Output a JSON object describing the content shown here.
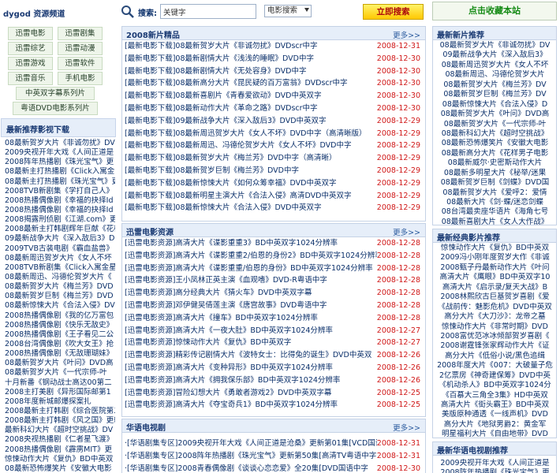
{
  "site": {
    "title": "dygod 资源频道"
  },
  "channels": [
    "迅雷电影",
    "迅雷剧集",
    "迅雷综艺",
    "迅雷动漫",
    "迅雷游戏",
    "迅雷软件",
    "迅雷音乐",
    "手机电影",
    "中英双字幕系列片",
    "粤语DVD电影系列片"
  ],
  "left_panel": {
    "title": "最新推荐影视下载",
    "items": [
      "08最新贺岁大片《非诚勿扰》DV",
      "2009央视开年大戏《人间正道是",
      "2008阵年热播剧《珠光宝气》更",
      "08最新主打热播剧《Click入寓金",
      "08最新主打热播剧《珠光宝气》更",
      "2008TVB新剧集《学打自己人》",
      "2008热播偶像剧《幸福的抉择Id",
      "2008热播偶像剧《幸福的抉择Id",
      "2008揭露刑侦剧《江湖.com》更",
      "2008最新主打韩剧辉年巨献《花样男",
      "09最新战争大片《深入敌后3》D",
      "2009TVB古装电剧《霸血盐兽》",
      "08最新周迅贺岁大片《女人不坏",
      "2008TVB新剧集《Click入寓金星",
      "08最新周迅、冯德伦贺岁大片《",
      "08最新贺岁大片《梅兰芳》DVD",
      "08最新贺岁巨制《梅兰芳》DVD",
      "08最新惊悚大片《合法入侵》DV",
      "2008热播偶像剧《我的亿万富包",
      "2008热播偶像剧《快乐无敌史》",
      "2008热播偶像剧《王子看见二公",
      "2008台湾偶像剧《吹大女王》抢",
      "2008热播偶像剧《无敌珊瑚妹》",
      "08最新贺岁大片《叶问》DVD高",
      "08最新贺岁大片《一代宗师-叶",
      "十月新番《钢动战士高达00第二",
      "2008主打美剧《异形国际邮第1",
      "2008年度新城邮爆探案扎",
      "2008最新主打韩剧《综合医院第二",
      "2008最新主打韩剧《风之国》更新",
      "最新科幻大片《超时空挑战》DV",
      "2008央视热播剧《仁者星飞渡》",
      "2008热播偶像剧《霹雳MIT》更",
      "惊悚动作大片《复仇》BD中英双",
      "08最新恐怖爆笑片《安徽大电影"
    ]
  },
  "search": {
    "label": "搜索:",
    "value": "关键字",
    "category": "电影搜索",
    "button": "立即搜索"
  },
  "sec1": {
    "title": "2008新片精品",
    "more": "更多>>",
    "rows": [
      {
        "text": "[最新电影下载]08最新贺岁大片《非诚勿扰》DVDscr中字",
        "date": "2008-12-31"
      },
      {
        "text": "[最新电影下载]08最新剧情大片《浅浅的睡眠》DVD中字",
        "date": "2008-12-30"
      },
      {
        "text": "[最新电影下载]08最新剧情大片《无处容身》DVD中字",
        "date": "2008-12-30"
      },
      {
        "text": "[最新电影下载]08最新高分大片《昆民疑的百万富翁》DVDscr中字",
        "date": "2008-12-30"
      },
      {
        "text": "[最新电影下载]08最新喜剧片《青春爱欲动》DVD中英双字",
        "date": "2008-12-30"
      },
      {
        "text": "[最新电影下载]08最新动作大片《革命之路》DVDscr中字",
        "date": "2008-12-30"
      },
      {
        "text": "[最新电影下载]09最新战争大片《深入敌后3》DVD中英双字",
        "date": "2008-12-29"
      },
      {
        "text": "[最新电影下载]08最新周迅贺岁大片《女人不坏》DVD中字（高清晰版）",
        "date": "2008-12-29"
      },
      {
        "text": "[最新电影下载]08最新周迅、冯德伦贺岁大片《女人不坏》DVD中字",
        "date": "2008-12-29"
      },
      {
        "text": "[最新电影下载]08最新贺岁大片《梅兰芳》DVD中字（高清晰）",
        "date": "2008-12-29"
      },
      {
        "text": "[最新电影下载]08最新贺岁巨制《梅兰芳》DVD中字",
        "date": "2008-12-29"
      },
      {
        "text": "[最新电影下载]08最新惊悚大片《如何众筹幸福》DVD中英双字",
        "date": "2008-12-29"
      },
      {
        "text": "[最新电影下载]08最新明星主演大片《合法入侵》高清DVD中英双字",
        "date": "2008-12-29"
      },
      {
        "text": "[最新电影下载]08最新惊悚大片《合法入侵》DVD中英双字",
        "date": "2008-12-29"
      }
    ]
  },
  "sec2": {
    "title": "迅雷电影资源",
    "more": "更多>>",
    "rows": [
      {
        "text": "[迅雷电影资源]高清大片《谍影重重3》BD中英双字1024分辨率",
        "date": "2008-12-28"
      },
      {
        "text": "[迅雷电影资源]高清大片《谍影重重2/伯恩的身份2》BD中英双字1024分辨率",
        "date": "2008-12-28"
      },
      {
        "text": "[迅雷电影资源]高清大片《谍影重重/伯恩的身份》BD中英双字1024分辨率",
        "date": "2008-12-28"
      },
      {
        "text": "[迅雷电影资源]王小凤林正英主演《血观嗜》DVD-R粤语中字",
        "date": "2008-12-28"
      },
      {
        "text": "[迅雷电影资源]高分经典大片《猜火车》DVD中英双字幕",
        "date": "2008-12-28"
      },
      {
        "text": "[迅雷电影资源]邓伊健吴倩莲主演《唐宫故事》DVD粤语中字",
        "date": "2008-12-28"
      },
      {
        "text": "[迅雷电影资源]高清大片《撞车》BD中英双字1024分辨率",
        "date": "2008-12-28"
      },
      {
        "text": "[迅雷电影资源]高清大片《一夜大肚》BD中英双字1024分辨率",
        "date": "2008-12-27"
      },
      {
        "text": "[迅雷电影资源]惊悚动作大片《复仇》BD中英双字",
        "date": "2008-12-27"
      },
      {
        "text": "[迅雷电影资源]精彩传记剧情大片《波特女士：比得兔的诞生》DVD中英双",
        "date": "2008-12-26"
      },
      {
        "text": "[迅雷电影资源]高清大片《变种异形》BD中英双字1024分辨率",
        "date": "2008-12-26"
      },
      {
        "text": "[迅雷电影资源]高清大片《拥我保乐部》BD中英双字1024分辨率",
        "date": "2008-12-26"
      },
      {
        "text": "[迅雷电影资源]冒险幻想大片《勇敢者游戏2》DVD中英双字幕",
        "date": "2008-12-25"
      },
      {
        "text": "[迅雷电影资源]高清大片《夺宝奇兵1》BD中英双字1024分辨率",
        "date": "2008-12-25"
      }
    ]
  },
  "sec3": {
    "title": "华语电视剧",
    "more": "更多>>",
    "rows": [
      {
        "text": "·[华语剧集专区]2009央视开年大戏《人间正道是沧桑》更新第01集[VCD国语",
        "date": "2008-12-31"
      },
      {
        "text": "·[华语剧集专区]2008阵年热播剧《珠光宝气》更新第50集[高清TV粤语中字",
        "date": "2008-12-31"
      },
      {
        "text": "·[华语剧集专区]2008青春偶像剧《谈谈心恋恋爱》全20集[DVD国语中字",
        "date": "2008-12-30"
      }
    ]
  },
  "bookmark": {
    "label": "点击收藏本站"
  },
  "right1": {
    "title": "最新新片推荐",
    "items": [
      "08最新贺岁大片《非诚勿扰》DV",
      "09最新战争大片《深入敌后3》",
      "08最新周迅贺岁大片《女人不坏",
      "08最新周迅、冯德伦贺岁大片",
      "08最新贺岁大片《梅兰芳》DV",
      "08最新贺岁巨制《梅兰芳》DV",
      "08最新惊悚大片《合法入侵》D",
      "08最新贺岁大片《叶问》DVD高",
      "08最新贺岁大片《一代宗师-叶",
      "08最新科幻大片《超时空挑战》",
      "08最新恐怖爆笑片《安徽大电影",
      "08最新高分大片《花样男子电影",
      "08最新威尔·史密斯动作大片",
      "08最新多明星大片《秘举/迷果",
      "08最新贺岁巨制《剑蝶》DVD国",
      "08最新贺岁大片《爱呼2：爱情",
      "08最新大片《剑·蝶/迷恋剑蝶",
      "08台湾最卖座华语片《海角七号",
      "08最新喜剧大片《女人大作战》"
    ]
  },
  "right2": {
    "title": "最新经典影片推荐",
    "items": [
      "惊悚动作大片《复仇》BD中英双",
      "2009冯小刚年度贺岁大作《非诚",
      "2008甄子丹最新动作大片《叶问",
      "高清大片《鹰眼》BD中英双字10",
      "高清大片《启示录/复天大战》B",
      "2008林熙欣古巨基贺岁喜剧《爱",
      "《战前传：魅影危机》DVD中英双",
      "高分大片《大刀沙》：龙帝之墓",
      "惊悚动作大片《非常时期》DVD",
      "2008富优范冰冰倾部贺岁喜剧《",
      "2008谢霆锋张家辉动作大片《证",
      "高分大片《低俗小说/黑色追缉",
      "2008年度大片《007：大破量子危",
      "2亿票房《神奇建保筹》DVD中英",
      "《机动杀人》BD中英双字1024分",
      "《百慕大三角全3集》HD中英双",
      "高清大片《街头霸王》BD中英双",
      "美版原种通透《一线声机》DVD",
      "高分大片《地狱男爵2：黄金军",
      "明星福利大片《自由地带》DVD"
    ]
  },
  "right3": {
    "title": "最新华语电视剧推荐",
    "items": [
      "2009央视开年大戏《人间正道是",
      "2008阵年热播剧《珠光宝气》更"
    ]
  }
}
